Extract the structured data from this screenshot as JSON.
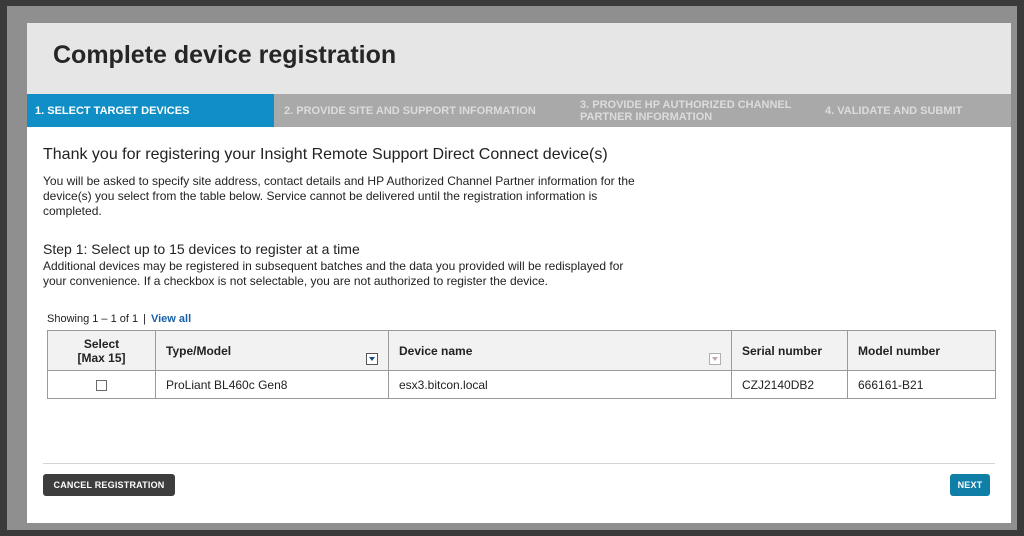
{
  "header": {
    "title": "Complete device registration"
  },
  "steps": [
    {
      "label": "1. SELECT TARGET DEVICES"
    },
    {
      "label": "2. PROVIDE SITE AND SUPPORT INFORMATION"
    },
    {
      "label": "3. PROVIDE HP AUTHORIZED CHANNEL PARTNER INFORMATION"
    },
    {
      "label": "4. VALIDATE AND SUBMIT"
    }
  ],
  "intro": {
    "title": "Thank you for registering your Insight Remote Support Direct Connect device(s)",
    "text": "You will be asked to specify site address, contact details and HP Authorized Channel Partner information for the device(s) you select from the table below. Service cannot be delivered until the registration information is completed."
  },
  "step1": {
    "title": "Step 1: Select up to 15 devices to register at a time",
    "text": "Additional devices may be registered in subsequent batches and the data you provided will be redisplayed for your convenience. If a checkbox is not selectable, you are not authorized to register the device."
  },
  "pagination": {
    "showing": "Showing 1 – 1 of 1",
    "separator": "|",
    "view_all": "View all"
  },
  "table": {
    "headers": {
      "select": "Select",
      "select_max": "[Max 15]",
      "type_model": "Type/Model",
      "device_name": "Device name",
      "serial_number": "Serial number",
      "model_number": "Model number"
    },
    "rows": [
      {
        "selected": false,
        "type_model": "ProLiant BL460c Gen8",
        "device_name": "esx3.bitcon.local",
        "serial_number": "CZJ2140DB2",
        "model_number": "666161-B21"
      }
    ]
  },
  "buttons": {
    "cancel": "CANCEL REGISTRATION",
    "next": "NEXT"
  },
  "colors": {
    "active_step": "#0f8fc6",
    "next_button": "#0f7fa8",
    "cancel_button": "#3d3d3d"
  },
  "icons": {
    "sort": "sort-dropdown-icon",
    "checkbox": "checkbox-unchecked"
  }
}
